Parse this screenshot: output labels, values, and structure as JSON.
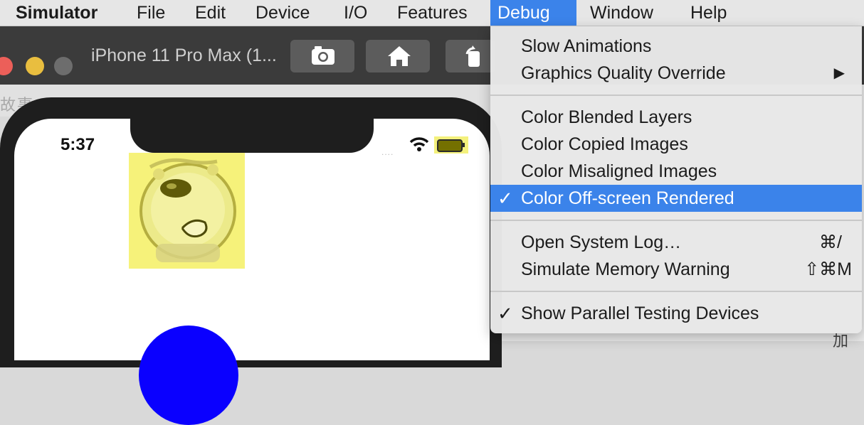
{
  "menubar": {
    "app": "Simulator",
    "items": [
      "File",
      "Edit",
      "Device",
      "I/O",
      "Features",
      "Debug",
      "Window",
      "Help"
    ]
  },
  "window": {
    "title": "iPhone 11 Pro Max (1..."
  },
  "background_text": "故事 ...  ...  ...  ...",
  "device": {
    "time": "5:37",
    "signal": "....",
    "highlight_color": "#f6f27a",
    "circle_color": "#0a00ff"
  },
  "debug_menu": {
    "slow_animations": "Slow Animations",
    "graphics_quality_override": "Graphics Quality Override",
    "submenu_arrow": "▶",
    "color_blended_layers": "Color Blended Layers",
    "color_copied_images": "Color Copied Images",
    "color_misaligned_images": "Color Misaligned Images",
    "color_offscreen_rendered": "Color Off-screen Rendered",
    "checkmark": "✓",
    "open_system_log": "Open System Log…",
    "open_system_log_shortcut": "⌘/",
    "simulate_memory_warning": "Simulate Memory Warning",
    "simulate_memory_warning_shortcut": "⇧⌘M",
    "show_parallel_testing_devices": "Show Parallel Testing Devices"
  },
  "right_text": "加",
  "colors": {
    "accent": "#3b83ea",
    "menu_bg": "#e8e8e8",
    "titlebar_bg": "#3b3b3b"
  }
}
